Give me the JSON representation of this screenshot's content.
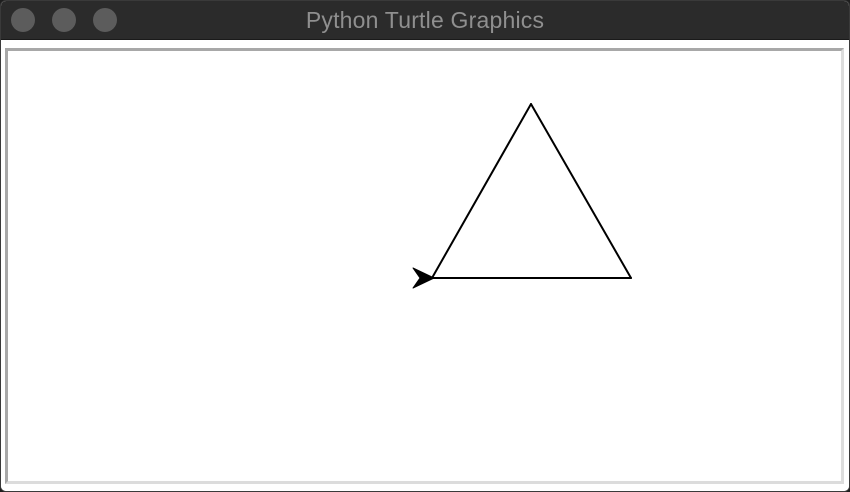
{
  "window": {
    "title": "Python Turtle Graphics"
  },
  "buttons": {
    "close": "close",
    "minimize": "minimize",
    "zoom": "zoom"
  },
  "colors": {
    "titlebar": "#2b2b2b",
    "title_text": "#8f8f8f",
    "traffic_lights": "#5c5c5c",
    "canvas_background": "#ffffff",
    "pen": "#000000"
  },
  "turtle": {
    "shape": "arrow-icon",
    "heading": "east"
  },
  "drawing": {
    "shape": "equilateral-triangle"
  }
}
